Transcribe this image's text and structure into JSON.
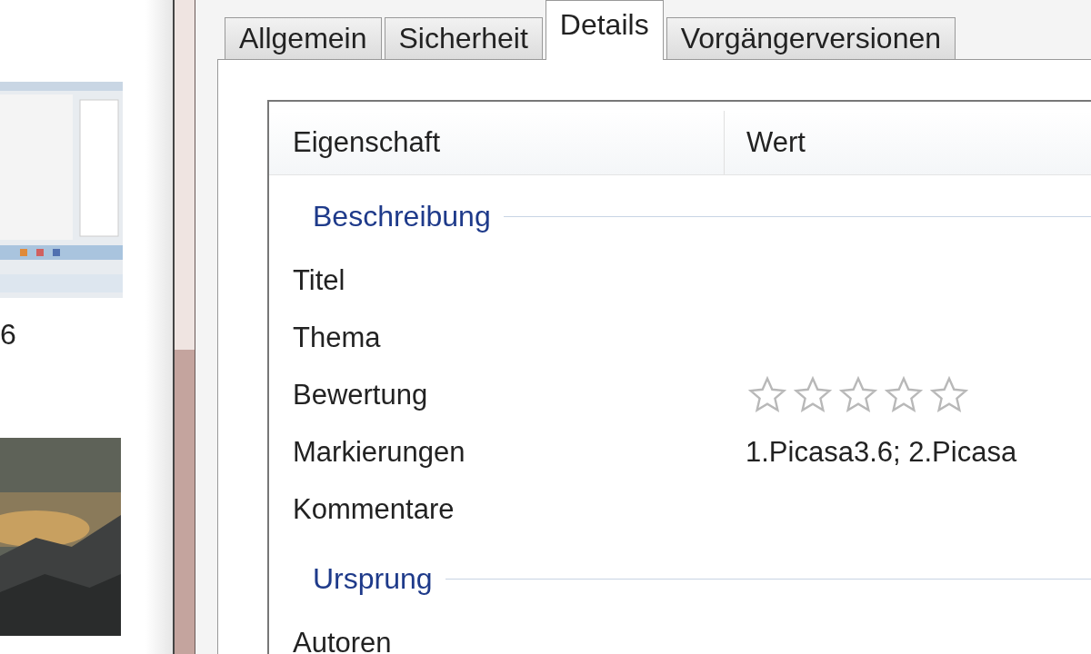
{
  "left_pane": {
    "items": [
      {
        "kind": "picture",
        "caption": "6"
      },
      {
        "kind": "picture"
      }
    ]
  },
  "tabs": [
    {
      "label": "Allgemein",
      "selected": false
    },
    {
      "label": "Sicherheit",
      "selected": false
    },
    {
      "label": "Details",
      "selected": true
    },
    {
      "label": "Vorgängerversionen",
      "selected": false
    }
  ],
  "details": {
    "columns": [
      "Eigenschaft",
      "Wert"
    ],
    "groups": [
      {
        "title": "Beschreibung",
        "rows": [
          {
            "kind": "text",
            "name": "Titel"
          },
          {
            "kind": "text",
            "name": "Thema"
          },
          {
            "kind": "rating",
            "name": "Bewertung",
            "stars": 0
          },
          {
            "kind": "text",
            "name": "Markierungen",
            "value": "1.Picasa3.6; 2.Picasa"
          },
          {
            "kind": "text",
            "name": "Kommentare"
          }
        ]
      },
      {
        "title": "Ursprung",
        "rows": [
          {
            "kind": "text",
            "name": "Autoren"
          }
        ]
      }
    ]
  }
}
